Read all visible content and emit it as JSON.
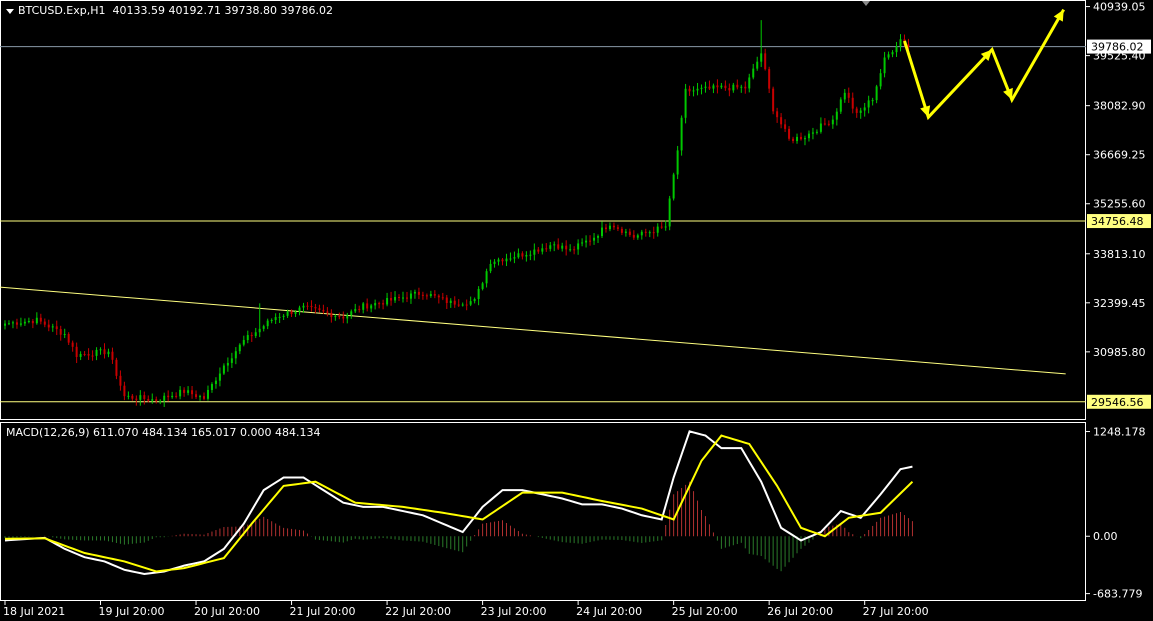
{
  "header": {
    "symbol": "BTCUSD.Exp,H1",
    "ohlc": "40133.59 40192.71 39738.80 39786.02"
  },
  "colors": {
    "background": "#000000",
    "bull": "#00c800",
    "bear": "#c80000",
    "macd_main": "#ffffff",
    "macd_signal": "#ffff00",
    "hist_pos": "#b03030",
    "hist_neg": "#2a7a2a",
    "level_line": "#ffff80",
    "bid_line": "#8a9aa8",
    "arrows": "#ffff00",
    "axis": "#ffffff"
  },
  "chart_data": [
    {
      "type": "candlestick",
      "name": "BTCUSD.Exp,H1",
      "ylim": [
        29050,
        41100
      ],
      "y_ticks": [
        "40939.05",
        "39525.40",
        "38082.90",
        "36669.25",
        "35255.60",
        "33813.10",
        "32399.45",
        "30985.80"
      ],
      "y_tick_values": [
        40939.05,
        39525.4,
        38082.9,
        36669.25,
        35255.6,
        33813.1,
        32399.45,
        30985.8
      ],
      "x_labels": [
        "18 Jul 2021",
        "19 Jul 20:00",
        "20 Jul 20:00",
        "21 Jul 20:00",
        "22 Jul 20:00",
        "23 Jul 20:00",
        "24 Jul 20:00",
        "25 Jul 20:00",
        "26 Jul 20:00",
        "27 Jul 20:00"
      ],
      "x_label_bars": [
        0,
        24,
        48,
        72,
        96,
        120,
        144,
        168,
        192,
        216
      ],
      "anchors": [
        [
          0,
          31800
        ],
        [
          8,
          31900
        ],
        [
          15,
          31500
        ],
        [
          18,
          30900
        ],
        [
          26,
          31000
        ],
        [
          30,
          29700
        ],
        [
          38,
          29600
        ],
        [
          45,
          29850
        ],
        [
          50,
          29650
        ],
        [
          55,
          30600
        ],
        [
          60,
          31300
        ],
        [
          68,
          32000
        ],
        [
          75,
          32250
        ],
        [
          85,
          32000
        ],
        [
          90,
          32300
        ],
        [
          98,
          32500
        ],
        [
          105,
          32700
        ],
        [
          112,
          32400
        ],
        [
          118,
          32450
        ],
        [
          122,
          33600
        ],
        [
          130,
          33800
        ],
        [
          138,
          34100
        ],
        [
          142,
          33900
        ],
        [
          148,
          34300
        ],
        [
          152,
          34700
        ],
        [
          158,
          34300
        ],
        [
          166,
          34600
        ],
        [
          169,
          36800
        ],
        [
          171,
          38500
        ],
        [
          180,
          38600
        ],
        [
          186,
          38600
        ],
        [
          190,
          39600
        ],
        [
          193,
          38000
        ],
        [
          197,
          37100
        ],
        [
          201,
          37200
        ],
        [
          208,
          37700
        ],
        [
          211,
          38500
        ],
        [
          214,
          37800
        ],
        [
          218,
          38300
        ],
        [
          221,
          39400
        ],
        [
          225,
          40000
        ],
        [
          227,
          39786
        ]
      ],
      "levels": [
        {
          "price": 34756.48,
          "label": "34756.48"
        },
        {
          "price": 29546.56,
          "label": "29546.56"
        }
      ],
      "bid": {
        "price": 39786.02,
        "label": "39786.02"
      },
      "trendline": {
        "from": [
          0,
          32850
        ],
        "to": [
          266,
          30350
        ]
      },
      "projection": [
        [
          226,
          39950
        ],
        [
          232,
          37750
        ],
        [
          248,
          39700
        ],
        [
          253,
          38250
        ],
        [
          266,
          40850
        ]
      ]
    },
    {
      "type": "line",
      "name": "MACD(12,26,9)",
      "values_text": "611.070 484.134 165.017 0.000 484.134",
      "ylim": [
        -760,
        1350
      ],
      "y_ticks": [
        "1248.178",
        "0.00",
        "-683.779"
      ],
      "y_tick_values": [
        1248.178,
        0,
        -683.779
      ],
      "main_anchors": [
        [
          0,
          -50
        ],
        [
          10,
          -20
        ],
        [
          15,
          -150
        ],
        [
          20,
          -250
        ],
        [
          25,
          -300
        ],
        [
          30,
          -400
        ],
        [
          35,
          -450
        ],
        [
          40,
          -420
        ],
        [
          45,
          -350
        ],
        [
          50,
          -300
        ],
        [
          55,
          -150
        ],
        [
          60,
          150
        ],
        [
          65,
          550
        ],
        [
          70,
          700
        ],
        [
          75,
          700
        ],
        [
          80,
          550
        ],
        [
          85,
          400
        ],
        [
          90,
          350
        ],
        [
          95,
          350
        ],
        [
          100,
          300
        ],
        [
          105,
          250
        ],
        [
          110,
          150
        ],
        [
          115,
          50
        ],
        [
          120,
          350
        ],
        [
          125,
          550
        ],
        [
          130,
          550
        ],
        [
          135,
          500
        ],
        [
          140,
          450
        ],
        [
          145,
          380
        ],
        [
          150,
          380
        ],
        [
          155,
          330
        ],
        [
          160,
          250
        ],
        [
          165,
          200
        ],
        [
          168,
          700
        ],
        [
          172,
          1250
        ],
        [
          176,
          1200
        ],
        [
          180,
          1050
        ],
        [
          185,
          1050
        ],
        [
          190,
          650
        ],
        [
          195,
          100
        ],
        [
          200,
          -50
        ],
        [
          205,
          50
        ],
        [
          210,
          300
        ],
        [
          215,
          220
        ],
        [
          220,
          500
        ],
        [
          225,
          800
        ],
        [
          228,
          830
        ]
      ],
      "signal_anchors": [
        [
          0,
          -30
        ],
        [
          10,
          -25
        ],
        [
          20,
          -200
        ],
        [
          30,
          -300
        ],
        [
          38,
          -420
        ],
        [
          45,
          -380
        ],
        [
          55,
          -260
        ],
        [
          62,
          150
        ],
        [
          70,
          600
        ],
        [
          78,
          650
        ],
        [
          88,
          400
        ],
        [
          100,
          350
        ],
        [
          110,
          280
        ],
        [
          120,
          200
        ],
        [
          130,
          520
        ],
        [
          140,
          520
        ],
        [
          150,
          420
        ],
        [
          160,
          330
        ],
        [
          168,
          200
        ],
        [
          175,
          900
        ],
        [
          180,
          1200
        ],
        [
          187,
          1100
        ],
        [
          194,
          600
        ],
        [
          200,
          100
        ],
        [
          206,
          0
        ],
        [
          212,
          220
        ],
        [
          220,
          280
        ],
        [
          228,
          650
        ]
      ]
    }
  ]
}
